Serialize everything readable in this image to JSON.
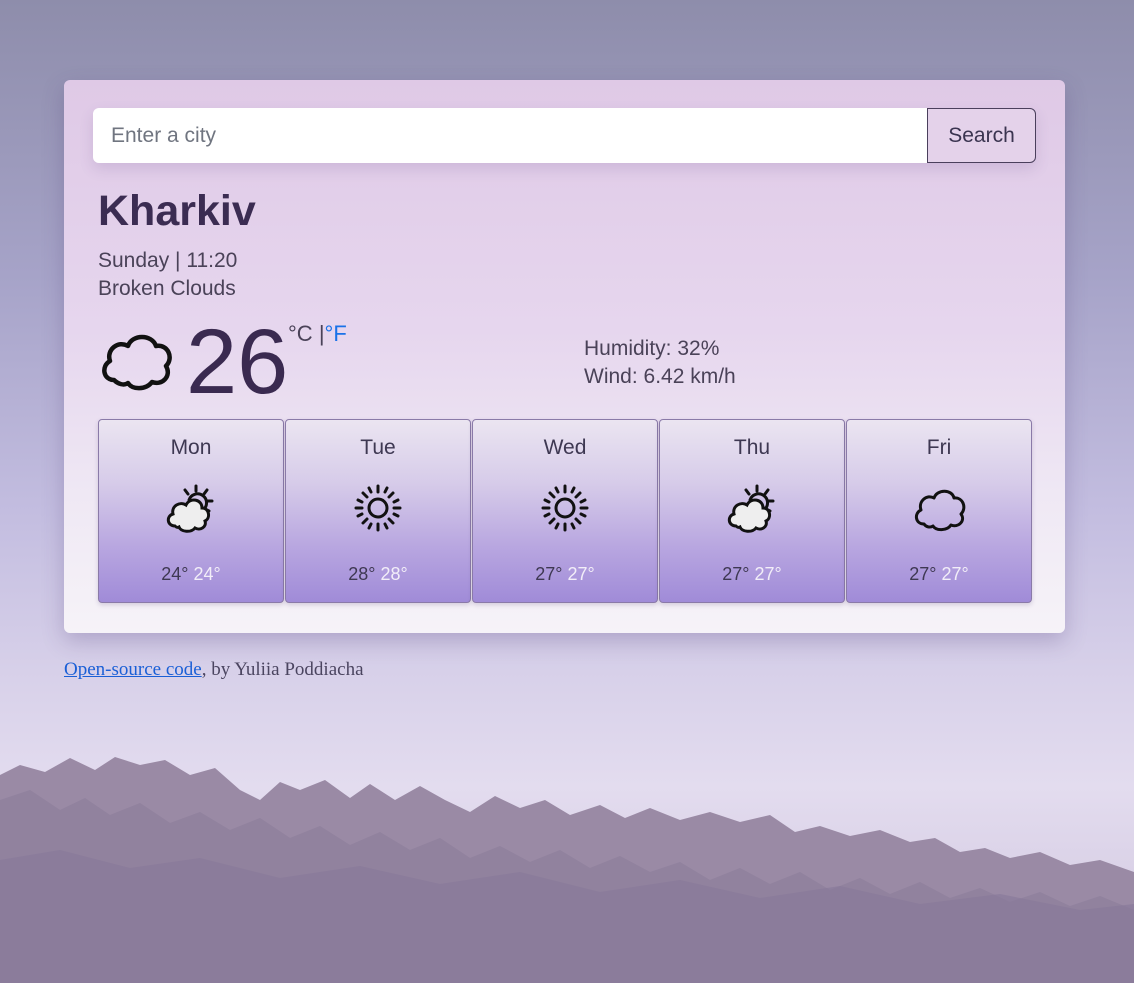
{
  "search": {
    "placeholder": "Enter a city",
    "button_label": "Search"
  },
  "current": {
    "city": "Kharkiv",
    "day_time": "Sunday | 11:20",
    "description": "Broken Clouds",
    "temperature": "26",
    "icon": "cloud-icon",
    "unit_celsius": "°C",
    "unit_separator": "|",
    "unit_fahrenheit": "°F",
    "humidity": "Humidity: 32%",
    "wind": "Wind: 6.42 km/h"
  },
  "forecast": [
    {
      "day": "Mon",
      "icon": "partly-sunny-icon",
      "max": "24°",
      "min": "24°"
    },
    {
      "day": "Tue",
      "icon": "sun-icon",
      "max": "28°",
      "min": "28°"
    },
    {
      "day": "Wed",
      "icon": "sun-icon",
      "max": "27°",
      "min": "27°"
    },
    {
      "day": "Thu",
      "icon": "partly-sunny-icon",
      "max": "27°",
      "min": "27°"
    },
    {
      "day": "Fri",
      "icon": "cloud-icon",
      "max": "27°",
      "min": "27°"
    }
  ],
  "footer": {
    "link_text": "Open-source code",
    "by_text": ", by Yuliia Poddiacha"
  },
  "colors": {
    "link": "#1a72e8",
    "card_tile_bottom": "#a08bd8",
    "heading": "#3b2c52"
  }
}
